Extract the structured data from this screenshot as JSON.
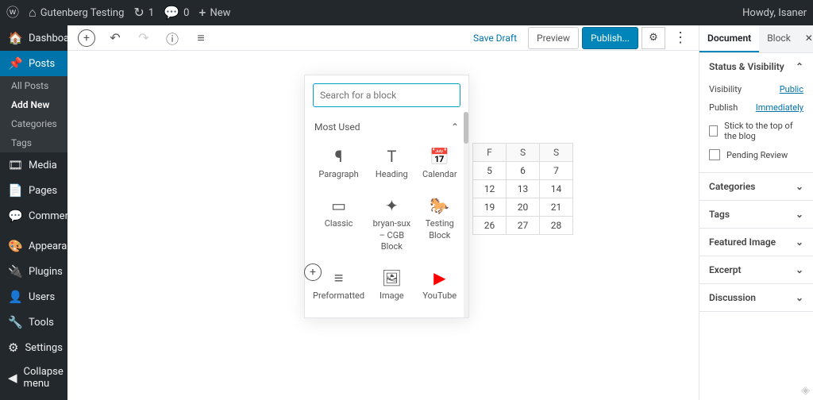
{
  "adminbar": {
    "site_name": "Gutenberg Testing",
    "updates_count": "1",
    "comments_count": "0",
    "new_label": "New",
    "howdy": "Howdy, Isaner"
  },
  "sidebar": {
    "items": [
      {
        "icon": "dashboard",
        "label": "Dashboard"
      },
      {
        "icon": "pin",
        "label": "Posts",
        "active": true
      },
      {
        "icon": "media",
        "label": "Media"
      },
      {
        "icon": "page",
        "label": "Pages"
      },
      {
        "icon": "comment",
        "label": "Comments"
      },
      {
        "icon": "appearance",
        "label": "Appearance"
      },
      {
        "icon": "plugin",
        "label": "Plugins"
      },
      {
        "icon": "user",
        "label": "Users"
      },
      {
        "icon": "tool",
        "label": "Tools"
      },
      {
        "icon": "settings",
        "label": "Settings"
      },
      {
        "icon": "collapse",
        "label": "Collapse menu"
      }
    ],
    "posts_submenu": [
      "All Posts",
      "Add New",
      "Categories",
      "Tags"
    ],
    "posts_submenu_active": "Add New"
  },
  "topbar": {
    "save_draft": "Save Draft",
    "preview": "Preview",
    "publish": "Publish..."
  },
  "block_inserter": {
    "search_placeholder": "Search for a block",
    "section_title": "Most Used",
    "blocks": [
      {
        "icon": "¶",
        "label": "Paragraph"
      },
      {
        "icon": "T",
        "label": "Heading"
      },
      {
        "icon": "📅",
        "label": "Calendar"
      },
      {
        "icon": "▭",
        "label": "Classic"
      },
      {
        "icon": "✦",
        "label": "bryan-sux – CGB Block"
      },
      {
        "icon": "🐎",
        "label": "Testing Block"
      },
      {
        "icon": "≡",
        "label": "Preformatted"
      },
      {
        "icon": "🖼",
        "label": "Image"
      },
      {
        "icon": "▶",
        "label": "YouTube",
        "red": true
      }
    ]
  },
  "calendar_fragment": {
    "headers": [
      "F",
      "S",
      "S"
    ],
    "rows": [
      [
        "5",
        "6",
        "7"
      ],
      [
        "12",
        "13",
        "14"
      ],
      [
        "19",
        "20",
        "21"
      ],
      [
        "26",
        "27",
        "28"
      ]
    ]
  },
  "rightpanel": {
    "tabs": [
      "Document",
      "Block"
    ],
    "active_tab": "Document",
    "status": {
      "title": "Status & Visibility",
      "visibility_label": "Visibility",
      "visibility_value": "Public",
      "publish_label": "Publish",
      "publish_value": "Immediately",
      "stick_label": "Stick to the top of the blog",
      "review_label": "Pending Review"
    },
    "sections": [
      "Categories",
      "Tags",
      "Featured Image",
      "Excerpt",
      "Discussion"
    ]
  }
}
